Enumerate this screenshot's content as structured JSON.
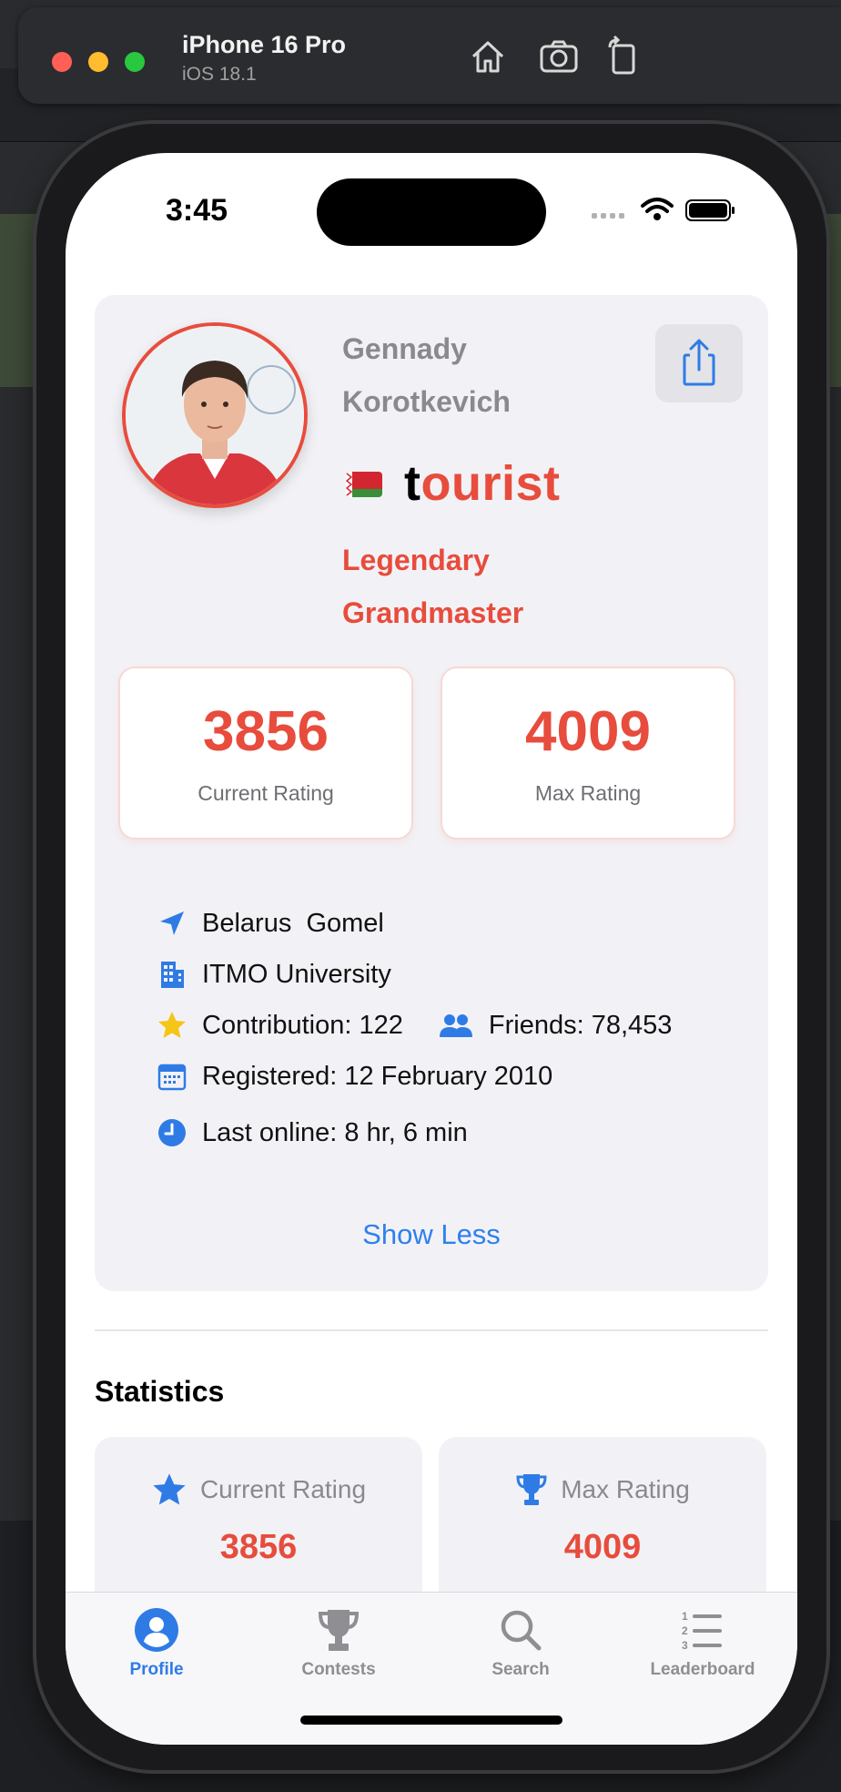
{
  "simulator": {
    "device_name": "iPhone 16 Pro",
    "os_version": "iOS 18.1"
  },
  "status_bar": {
    "time": "3:45"
  },
  "profile": {
    "full_name": "Gennady Korotkevich",
    "handle_first": "t",
    "handle_rest": "ourist",
    "rank": "Legendary Grandmaster",
    "current_rating": "3856",
    "current_rating_label": "Current Rating",
    "max_rating": "4009",
    "max_rating_label": "Max Rating",
    "country": "Belarus",
    "city": "Gomel",
    "organization": "ITMO University",
    "contribution": "Contribution: 122",
    "friends": "Friends: 78,453",
    "registered": "Registered: 12 February 2010",
    "last_online": "Last online: 8 hr, 6 min",
    "show_less": "Show Less"
  },
  "statistics": {
    "title": "Statistics",
    "cards": [
      {
        "label": "Current Rating",
        "value": "3856",
        "icon": "star-icon"
      },
      {
        "label": "Max Rating",
        "value": "4009",
        "icon": "trophy-icon"
      }
    ]
  },
  "tabbar": {
    "items": [
      {
        "label": "Profile",
        "icon": "person-circle-icon",
        "active": true
      },
      {
        "label": "Contests",
        "icon": "trophy-icon",
        "active": false
      },
      {
        "label": "Search",
        "icon": "magnifier-icon",
        "active": false
      },
      {
        "label": "Leaderboard",
        "icon": "numbered-list-icon",
        "active": false
      }
    ]
  },
  "colors": {
    "accent_red": "#e74c3c",
    "accent_blue": "#2f80ed",
    "card_bg": "#f2f2f6"
  }
}
